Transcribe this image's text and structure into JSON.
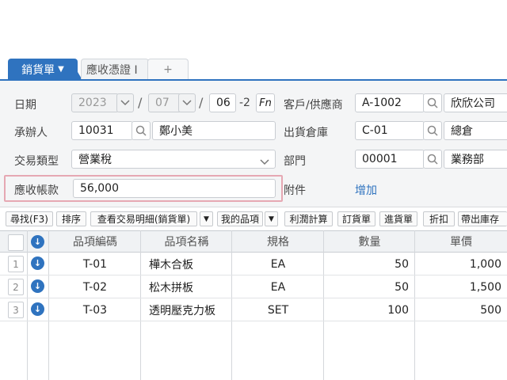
{
  "tabs": [
    {
      "label": "銷貨單",
      "caret": "▼"
    },
    {
      "label": "應收憑證 I"
    },
    {
      "label": "+"
    }
  ],
  "form": {
    "date_label": "日期",
    "year": "2023",
    "month": "07",
    "day": "06",
    "day_suffix": "-2",
    "fn_label": "Fn",
    "date_sep": "/",
    "customer_label": "客戶/供應商",
    "customer_code": "A-1002",
    "customer_name": "欣欣公司",
    "handler_label": "承辦人",
    "handler_code": "10031",
    "handler_name": "鄭小美",
    "warehouse_label": "出貨倉庫",
    "warehouse_code": "C-01",
    "warehouse_name": "總倉",
    "trade_type_label": "交易類型",
    "trade_type_value": "營業稅",
    "dept_label": "部門",
    "dept_code": "00001",
    "dept_name": "業務部",
    "receivable_label": "應收帳款",
    "receivable_value": "56,000",
    "attach_label": "附件",
    "attach_link": "增加"
  },
  "toolbar": {
    "search": "尋找(F3)",
    "sort": "排序",
    "view_detail": "查看交易明細(銷貨單)",
    "my_items": "我的品項",
    "profit_calc": "利潤計算",
    "order": "訂貨單",
    "purchase": "進貨單",
    "discount": "折扣",
    "stock": "帶出庫存"
  },
  "grid": {
    "headers": [
      "品項編碼",
      "品項名稱",
      "規格",
      "數量",
      "單價"
    ],
    "rows": [
      {
        "num": "1",
        "code": "T-01",
        "name": "樺木合板",
        "spec": "EA",
        "qty": "50",
        "price": "1,000"
      },
      {
        "num": "2",
        "code": "T-02",
        "name": "松木拼板",
        "spec": "EA",
        "qty": "50",
        "price": "1,500"
      },
      {
        "num": "3",
        "code": "T-03",
        "name": "透明壓克力板",
        "spec": "SET",
        "qty": "100",
        "price": "500"
      }
    ]
  },
  "colors": {
    "accent": "#2f73bf",
    "highlight_border": "#e6a8b3"
  },
  "icons": [
    "dropdown-icon",
    "search-icon",
    "download-circle-icon"
  ]
}
